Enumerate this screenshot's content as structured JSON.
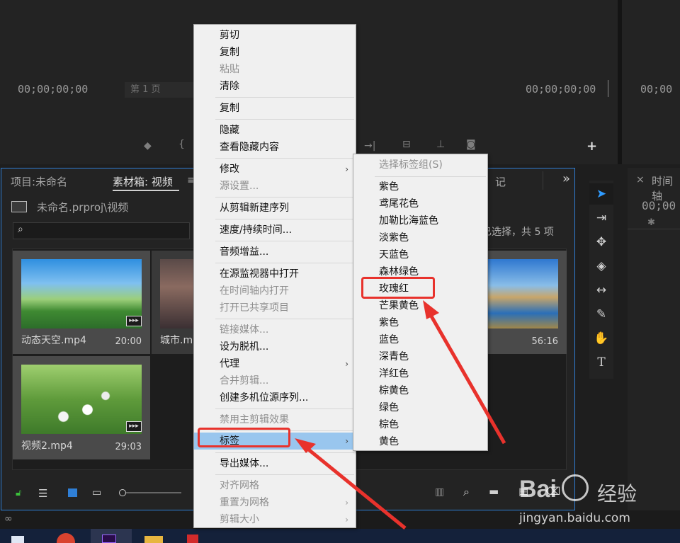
{
  "source_monitor": {
    "timecode_left": "00;00;00;00",
    "page_select": "第 1 页"
  },
  "program_monitor": {
    "timecode_right": "00;00;00;00"
  },
  "far_right": {
    "timecode": "00;00"
  },
  "project_panel": {
    "tab_project": "项目:未命名",
    "tab_bin": "素材箱: 视频",
    "tab_bin_menu": "≡",
    "tab_extra": "记",
    "overflow": "»",
    "path": "未命名.prproj\\视频",
    "selection_status": "已选择，共 5 项",
    "clips": [
      {
        "name": "动态天空.mp4",
        "duration": "20:00"
      },
      {
        "name": "城市.m",
        "duration": ""
      },
      {
        "name": "",
        "duration": "56:16"
      },
      {
        "name": "视频2.mp4",
        "duration": "29:03"
      }
    ]
  },
  "timeline_panel": {
    "tab_close": "×",
    "tab_label": "时间轴",
    "timecode": "00;00"
  },
  "context_menu": {
    "items": [
      {
        "label": "剪切",
        "disabled": false
      },
      {
        "label": "复制",
        "disabled": false
      },
      {
        "label": "粘贴",
        "disabled": true
      },
      {
        "label": "清除",
        "disabled": false
      },
      {
        "label": "复制",
        "disabled": false
      },
      {
        "label": "隐藏",
        "disabled": false
      },
      {
        "label": "查看隐藏内容",
        "disabled": false
      },
      {
        "label": "修改",
        "disabled": false,
        "submenu": true
      },
      {
        "label": "源设置...",
        "disabled": true
      },
      {
        "label": "从剪辑新建序列",
        "disabled": false
      },
      {
        "label": "速度/持续时间...",
        "disabled": false
      },
      {
        "label": "音频增益...",
        "disabled": false
      },
      {
        "label": "在源监视器中打开",
        "disabled": false
      },
      {
        "label": "在时间轴内打开",
        "disabled": true
      },
      {
        "label": "打开已共享项目",
        "disabled": true
      },
      {
        "label": "链接媒体...",
        "disabled": true
      },
      {
        "label": "设为脱机...",
        "disabled": false
      },
      {
        "label": "代理",
        "disabled": false,
        "submenu": true
      },
      {
        "label": "合并剪辑...",
        "disabled": true
      },
      {
        "label": "创建多机位源序列...",
        "disabled": false
      },
      {
        "label": "禁用主剪辑效果",
        "disabled": true
      },
      {
        "label": "标签",
        "disabled": false,
        "submenu": true,
        "highlighted": true
      },
      {
        "label": "导出媒体...",
        "disabled": false
      },
      {
        "label": "对齐网格",
        "disabled": true
      },
      {
        "label": "重置为网格",
        "disabled": true,
        "submenu": true
      },
      {
        "label": "剪辑大小",
        "disabled": true,
        "submenu": true
      }
    ],
    "submenu_arrow": "›"
  },
  "label_submenu": {
    "header": "选择标签组(S)",
    "items": [
      "紫色",
      "鸢尾花色",
      "加勒比海蓝色",
      "淡紫色",
      "天蓝色",
      "森林绿色",
      "玫瑰红",
      "芒果黄色",
      "紫色",
      "蓝色",
      "深青色",
      "洋红色",
      "棕黄色",
      "绿色",
      "棕色",
      "黄色"
    ],
    "annotated_item": "玫瑰红"
  },
  "watermark": {
    "brand": "Bai",
    "brand2": "经验",
    "url": "jingyan.baidu.com"
  },
  "colors": {
    "accent_blue": "#2f7fd6",
    "menu_highlight": "#99c6ee",
    "annotation_red": "#e8322c",
    "lock_green": "#3bbf3b"
  }
}
